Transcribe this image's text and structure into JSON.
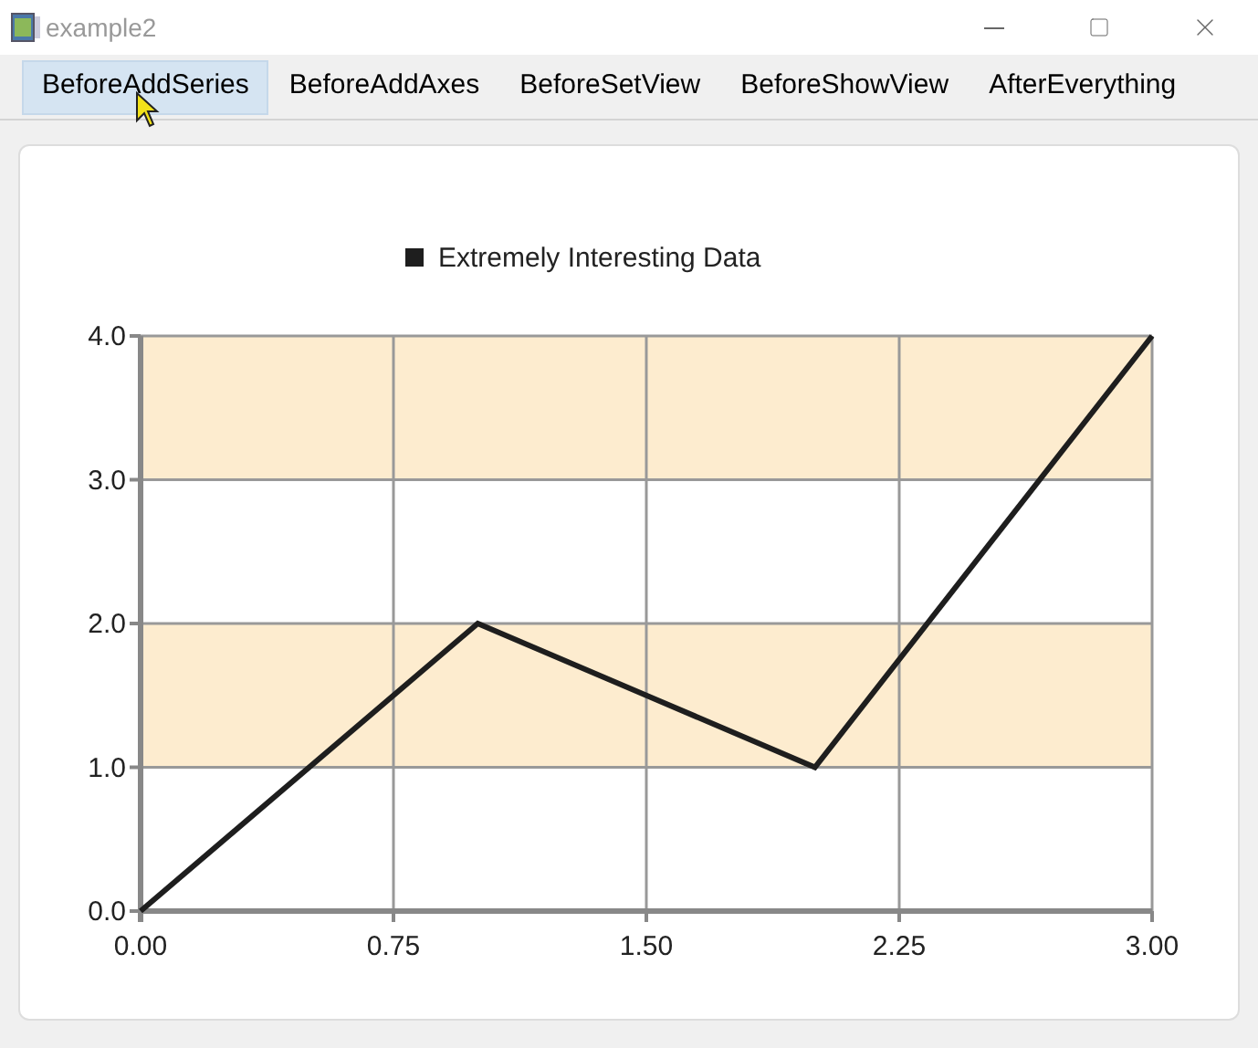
{
  "window": {
    "title": "example2"
  },
  "toolbar": {
    "items": [
      {
        "label": "BeforeAddSeries",
        "selected": true
      },
      {
        "label": "BeforeAddAxes",
        "selected": false
      },
      {
        "label": "BeforeSetView",
        "selected": false
      },
      {
        "label": "BeforeShowView",
        "selected": false
      },
      {
        "label": "AfterEverything",
        "selected": false
      }
    ]
  },
  "chart": {
    "chart_data": {
      "type": "line",
      "grid": true,
      "bands": [
        {
          "axis": "y",
          "from": 1,
          "to": 2,
          "color": "#fdeccf"
        },
        {
          "axis": "y",
          "from": 3,
          "to": 4,
          "color": "#fdeccf"
        }
      ],
      "x": [
        0,
        1,
        2,
        3
      ],
      "series": [
        {
          "name": "Extremely Interesting Data",
          "color": "#1e1e1e",
          "values": [
            0,
            2,
            1,
            4
          ]
        }
      ],
      "xlim": [
        0,
        3
      ],
      "ylim": [
        0,
        4
      ],
      "xticks": [
        {
          "value": 0,
          "label": "0.00"
        },
        {
          "value": 0.75,
          "label": "0.75"
        },
        {
          "value": 1.5,
          "label": "1.50"
        },
        {
          "value": 2.25,
          "label": "2.25"
        },
        {
          "value": 3,
          "label": "3.00"
        }
      ],
      "yticks": [
        {
          "value": 0,
          "label": "0.0"
        },
        {
          "value": 1,
          "label": "1.0"
        },
        {
          "value": 2,
          "label": "2.0"
        },
        {
          "value": 3,
          "label": "3.0"
        },
        {
          "value": 4,
          "label": "4.0"
        }
      ]
    }
  }
}
